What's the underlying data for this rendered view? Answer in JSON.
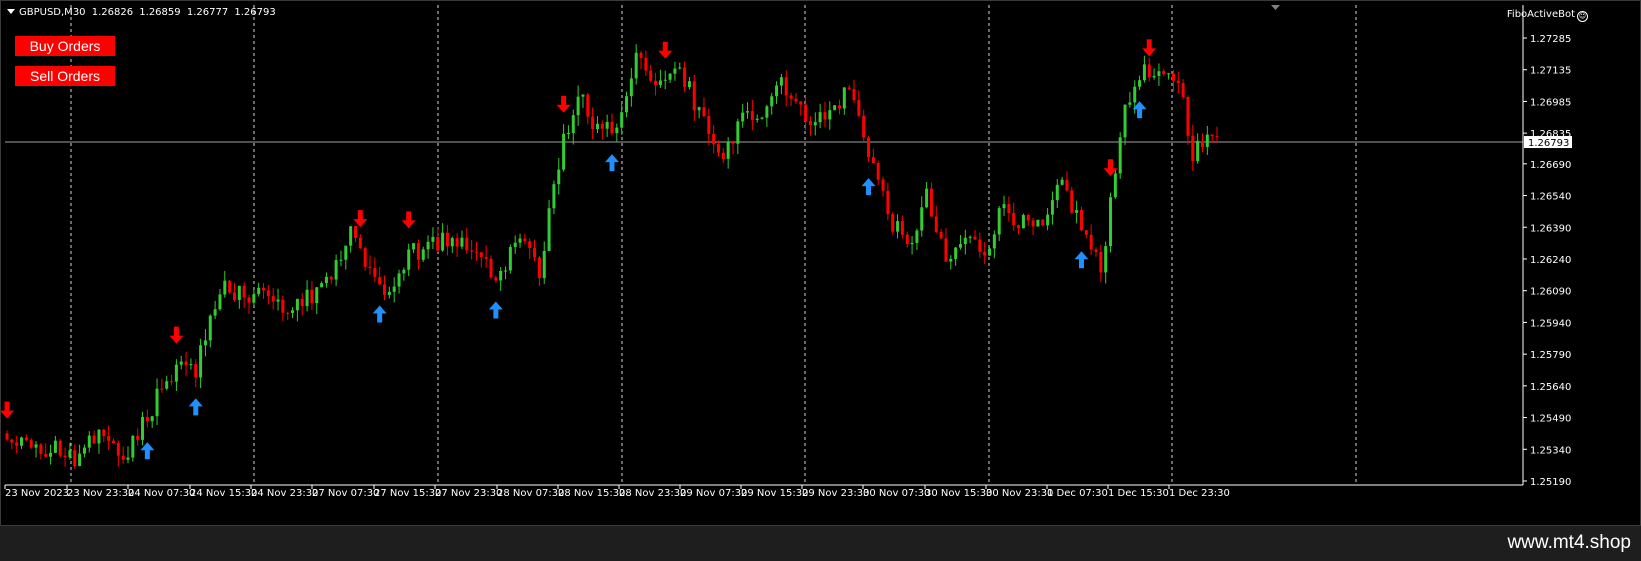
{
  "header": {
    "symbol_timeframe": "GBPUSD,M30",
    "open": "1.26826",
    "high": "1.26859",
    "low": "1.26777",
    "close": "1.26793"
  },
  "buttons": {
    "buy_label": "Buy Orders",
    "sell_label": "Sell Orders"
  },
  "ea_name": "FiboActiveBot",
  "watermark": "www.mt4.shop",
  "colors": {
    "background": "#000000",
    "bull": "#32cd32",
    "bear": "#ff0000",
    "up_arrow": "#1e90ff",
    "down_arrow": "#ff0000"
  },
  "chart_data": {
    "type": "candlestick",
    "symbol": "GBPUSD",
    "timeframe": "M30",
    "current_price": "1.26793",
    "ylim": [
      1.2512,
      1.2736
    ],
    "price_ticks": [
      "1.27285",
      "1.27135",
      "1.26985",
      "1.26835",
      "1.26690",
      "1.26540",
      "1.26390",
      "1.26240",
      "1.26090",
      "1.25940",
      "1.25790",
      "1.25640",
      "1.25490",
      "1.25340",
      "1.25190"
    ],
    "time_labels": [
      "23 Nov 2023",
      "23 Nov 23:30",
      "24 Nov 07:30",
      "24 Nov 15:30",
      "24 Nov 23:30",
      "27 Nov 07:30",
      "27 Nov 15:30",
      "27 Nov 23:30",
      "28 Nov 07:30",
      "28 Nov 15:30",
      "28 Nov 23:30",
      "29 Nov 07:30",
      "29 Nov 15:30",
      "29 Nov 23:30",
      "30 Nov 07:30",
      "30 Nov 15:30",
      "30 Nov 23:30",
      "1 Dec 07:30",
      "1 Dec 15:30",
      "1 Dec 23:30"
    ],
    "price_path": [
      [
        0,
        1.2539
      ],
      [
        6,
        1.2532
      ],
      [
        10,
        1.2534
      ],
      [
        14,
        1.2529
      ],
      [
        19,
        1.254
      ],
      [
        24,
        1.2527
      ],
      [
        29,
        1.255
      ],
      [
        35,
        1.2575
      ],
      [
        39,
        1.2571
      ],
      [
        44,
        1.261
      ],
      [
        49,
        1.2606
      ],
      [
        53,
        1.2608
      ],
      [
        58,
        1.2599
      ],
      [
        62,
        1.2605
      ],
      [
        67,
        1.2619
      ],
      [
        71,
        1.2637
      ],
      [
        75,
        1.2616
      ],
      [
        79,
        1.2605
      ],
      [
        83,
        1.2626
      ],
      [
        87,
        1.2629
      ],
      [
        91,
        1.2634
      ],
      [
        96,
        1.2631
      ],
      [
        101,
        1.2615
      ],
      [
        106,
        1.2636
      ],
      [
        110,
        1.2617
      ],
      [
        114,
        1.2671
      ],
      [
        118,
        1.2703
      ],
      [
        122,
        1.2683
      ],
      [
        126,
        1.269
      ],
      [
        130,
        1.2718
      ],
      [
        135,
        1.2708
      ],
      [
        139,
        1.2712
      ],
      [
        144,
        1.269
      ],
      [
        148,
        1.2673
      ],
      [
        152,
        1.269
      ],
      [
        156,
        1.2695
      ],
      [
        160,
        1.271
      ],
      [
        164,
        1.2693
      ],
      [
        169,
        1.269
      ],
      [
        174,
        1.2705
      ],
      [
        178,
        1.2676
      ],
      [
        182,
        1.2646
      ],
      [
        186,
        1.2628
      ],
      [
        190,
        1.2653
      ],
      [
        194,
        1.2621
      ],
      [
        198,
        1.2634
      ],
      [
        202,
        1.2628
      ],
      [
        206,
        1.265
      ],
      [
        210,
        1.264
      ],
      [
        214,
        1.2637
      ],
      [
        218,
        1.266
      ],
      [
        222,
        1.2639
      ],
      [
        226,
        1.2618
      ],
      [
        230,
        1.2685
      ],
      [
        234,
        1.2713
      ],
      [
        238,
        1.2708
      ],
      [
        242,
        1.271
      ],
      [
        245,
        1.2675
      ],
      [
        250,
        1.2682
      ]
    ],
    "up_signal_bars": [
      29,
      39,
      77,
      101,
      125,
      178,
      222,
      234
    ],
    "down_signal_bars": [
      0,
      35,
      73,
      83,
      115,
      136,
      228,
      236
    ]
  }
}
